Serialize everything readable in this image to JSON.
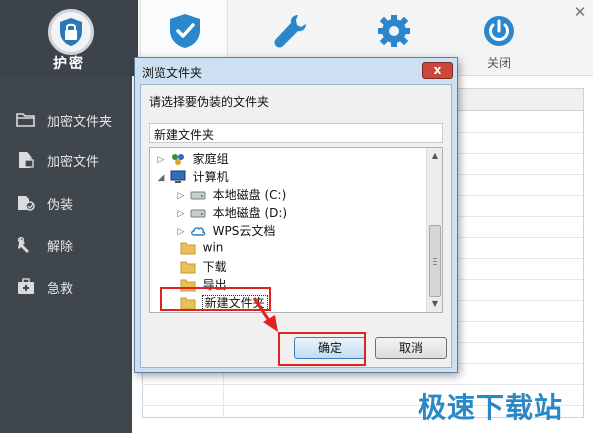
{
  "app": {
    "logo_label": "护密",
    "top_nav": [
      {
        "label": "",
        "icon": "shield-icon"
      },
      {
        "label": "",
        "icon": "wrench-icon"
      },
      {
        "label": "",
        "icon": "gear-icon"
      },
      {
        "label": "关闭",
        "icon": "power-icon"
      }
    ],
    "close_glyph": "✕"
  },
  "sidebar": {
    "items": [
      {
        "label": "加密文件夹",
        "icon": "folder-icon"
      },
      {
        "label": "加密文件",
        "icon": "file-lock-icon"
      },
      {
        "label": "伪装",
        "icon": "disguise-icon"
      },
      {
        "label": "解除",
        "icon": "unlock-icon"
      },
      {
        "label": "急救",
        "icon": "first-aid-icon"
      }
    ]
  },
  "dialog": {
    "title": "浏览文件夹",
    "close_glyph": "x",
    "prompt": "请选择要伪装的文件夹",
    "selected_path": "新建文件夹",
    "tree": [
      {
        "label": "家庭组",
        "icon": "homegroup-icon",
        "arrow": "▷"
      },
      {
        "label": "计算机",
        "icon": "computer-icon",
        "arrow": "◢"
      },
      {
        "label": "本地磁盘 (C:)",
        "icon": "drive-icon",
        "arrow": "▷"
      },
      {
        "label": "本地磁盘 (D:)",
        "icon": "drive-icon",
        "arrow": "▷"
      },
      {
        "label": "WPS云文档",
        "icon": "cloud-icon",
        "arrow": "▷"
      },
      {
        "label": "win",
        "icon": "folder-icon",
        "arrow": ""
      },
      {
        "label": "下载",
        "icon": "folder-icon",
        "arrow": ""
      },
      {
        "label": "导出",
        "icon": "folder-icon",
        "arrow": ""
      },
      {
        "label": "新建文件夹",
        "icon": "folder-icon",
        "arrow": "",
        "selected": true
      }
    ],
    "ok_label": "确定",
    "cancel_label": "取消"
  },
  "watermark": "极速下载站",
  "colors": {
    "sidebar_bg": "#3f464c",
    "logo_bg": "#3d434a",
    "accent_blue": "#2a88c6",
    "highlight_red": "#e0231c",
    "dialog_frame": "#cde0f2"
  }
}
